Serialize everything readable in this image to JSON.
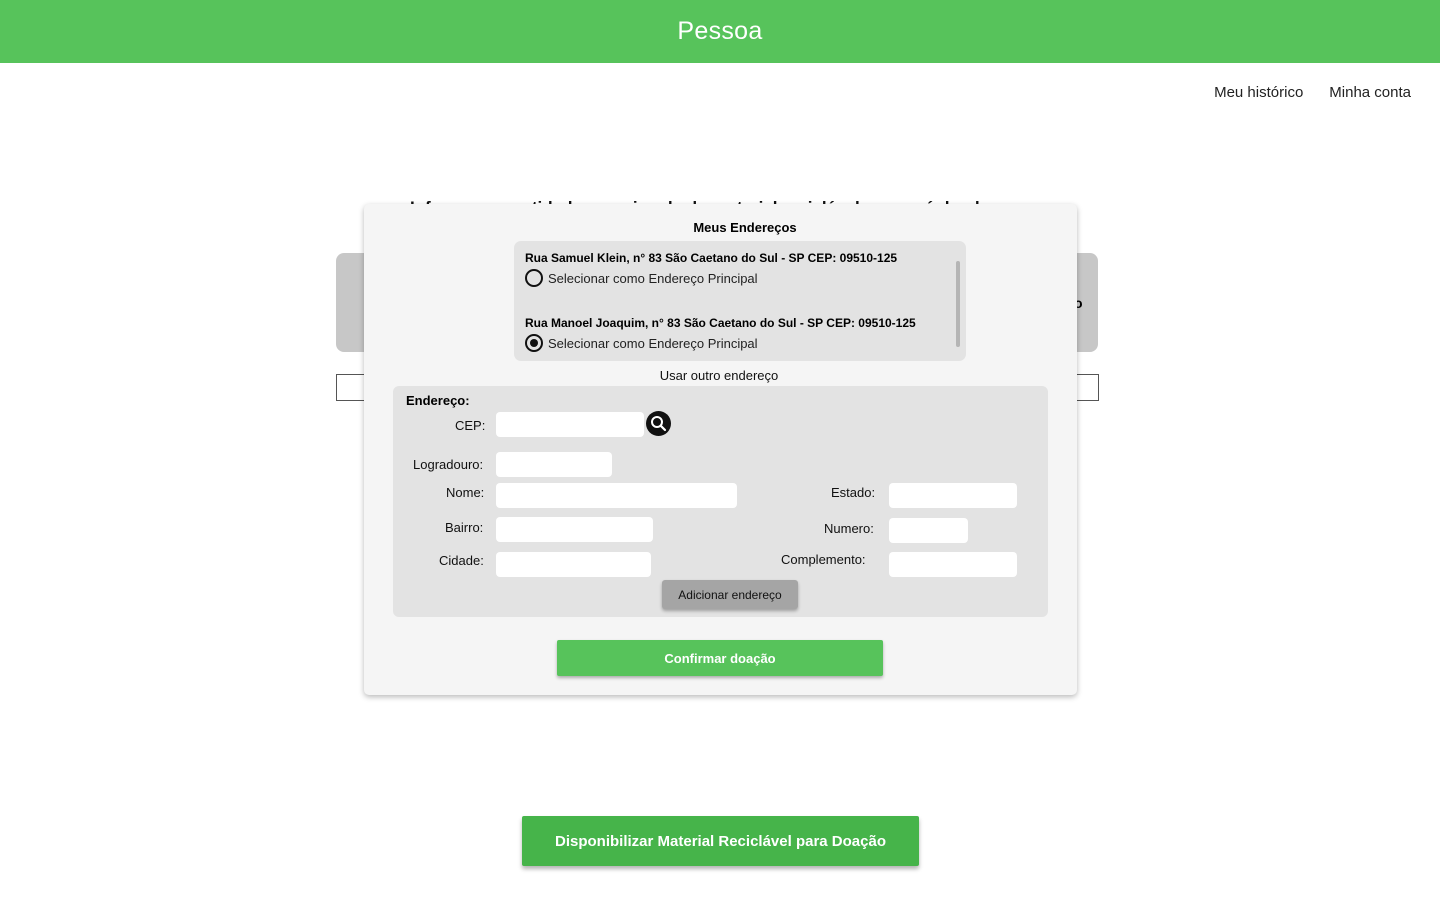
{
  "header": {
    "title": "Pessoa"
  },
  "nav": {
    "history": "Meu histórico",
    "account": "Minha conta"
  },
  "background": {
    "heading": "Informe a quantidade aproximada do material reciclável que será doado",
    "card_text": "o"
  },
  "modal": {
    "title": "Meus Endereços",
    "addresses": [
      {
        "text": "Rua Samuel Klein, n° 83 São Caetano do Sul - SP  CEP: 09510-125",
        "option_label": "Selecionar como Endereço Principal",
        "selected": false
      },
      {
        "text": "Rua Manoel Joaquim, n° 83 São Caetano do Sul - SP  CEP: 09510-125",
        "option_label": "Selecionar como Endereço Principal",
        "selected": true
      }
    ],
    "other_address": "Usar outro endereço",
    "form": {
      "section_label": "Endereço:",
      "cep_label": "CEP:",
      "logradouro_label": "Logradouro:",
      "nome_label": "Nome:",
      "bairro_label": "Bairro:",
      "cidade_label": "Cidade:",
      "estado_label": "Estado:",
      "numero_label": "Numero:",
      "complemento_label": "Complemento:",
      "add_button": "Adicionar endereço"
    },
    "confirm_button": "Confirmar doação"
  },
  "cta": {
    "label": "Disponibilizar Material Reciclável para Doação"
  },
  "icons": {
    "search": "search-icon"
  },
  "colors": {
    "brand_green": "#57c35b",
    "cta_green": "#46b44a",
    "panel_gray": "#e3e3e3",
    "modal_bg": "#f5f5f5"
  }
}
